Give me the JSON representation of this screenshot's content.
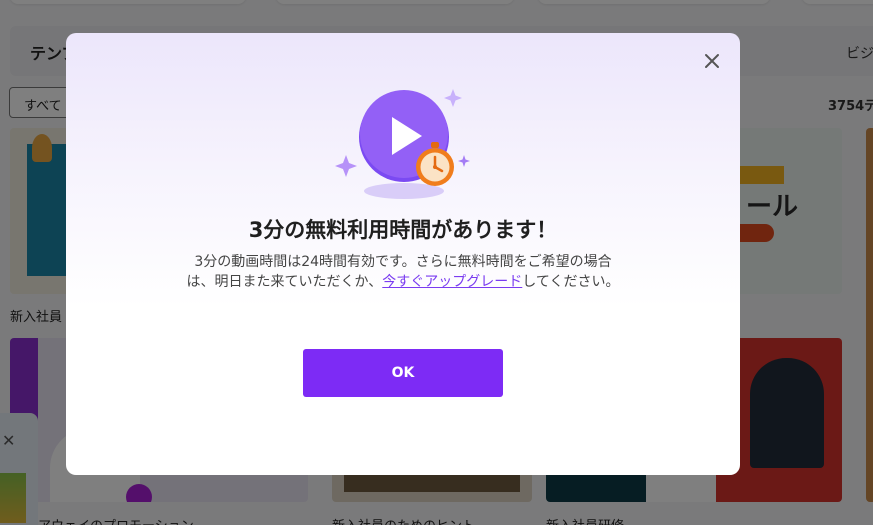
{
  "background": {
    "section_title": "テンプ",
    "section_right_label": "ビジ",
    "filter_label": "すべて",
    "count_label": "3754テ",
    "section2_label": "新入社員",
    "thumb_labels": [
      "アウェイのプロモーション",
      "新入社員のためのヒント",
      "新入社員研修"
    ]
  },
  "modal": {
    "title": "3分の無料利用時間があります！",
    "desc_line1": "3分の動画時間は24時間有効です。さらに無料時間をご希望の場合",
    "desc_line2_pre": "は、明日また来ていただくか、",
    "desc_link": "今すぐアップグレード",
    "desc_line2_post": "してください。",
    "ok_label": "OK",
    "icons": {
      "close": "close-icon",
      "hero": "play-timer-icon"
    },
    "colors": {
      "accent": "#7d2bf5",
      "link": "#7a3cf0"
    }
  }
}
